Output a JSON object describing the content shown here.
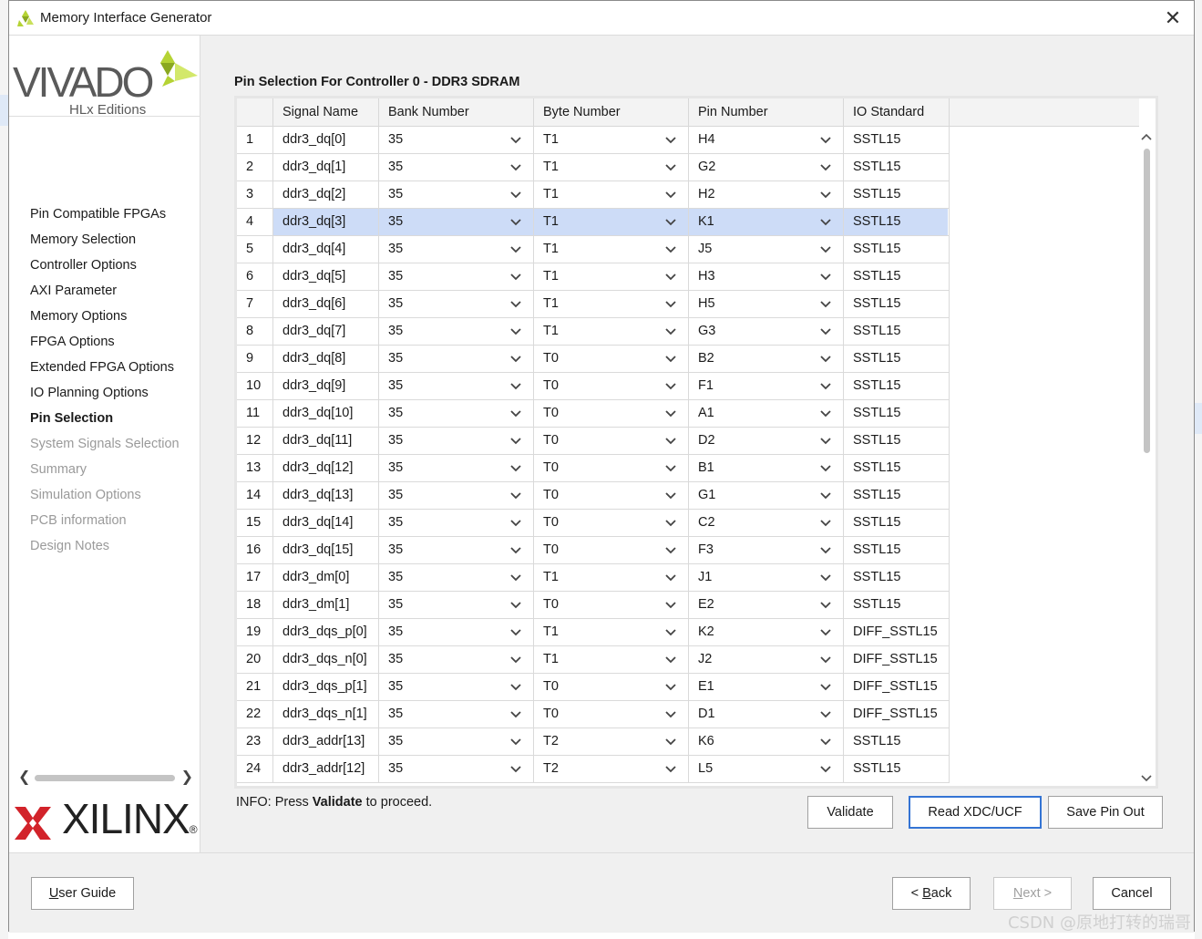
{
  "window": {
    "title": "Memory Interface Generator",
    "close_glyph": "✕"
  },
  "brand": {
    "vivado": "VIVADO",
    "vivado_sub": "HLx Editions",
    "xilinx": "XILINX",
    "registered": "®",
    "accent_green": "#b5d334"
  },
  "steps": [
    {
      "label": "Pin Compatible FPGAs",
      "state": "done"
    },
    {
      "label": "Memory Selection",
      "state": "done"
    },
    {
      "label": "Controller Options",
      "state": "done"
    },
    {
      "label": "AXI Parameter",
      "state": "done"
    },
    {
      "label": "Memory Options",
      "state": "done"
    },
    {
      "label": "FPGA Options",
      "state": "done"
    },
    {
      "label": "Extended FPGA Options",
      "state": "done"
    },
    {
      "label": "IO Planning Options",
      "state": "done"
    },
    {
      "label": "Pin Selection",
      "state": "current"
    },
    {
      "label": "System Signals Selection",
      "state": "disabled"
    },
    {
      "label": "Summary",
      "state": "disabled"
    },
    {
      "label": "Simulation Options",
      "state": "disabled"
    },
    {
      "label": "PCB information",
      "state": "disabled"
    },
    {
      "label": "Design Notes",
      "state": "disabled"
    }
  ],
  "left_scroll": {
    "left": "❮",
    "right": "❯"
  },
  "section_title": "Pin Selection For Controller 0 - DDR3 SDRAM",
  "table": {
    "columns": [
      "",
      "Signal Name",
      "Bank Number",
      "Byte Number",
      "Pin Number",
      "IO Standard"
    ],
    "selected_row": 4,
    "rows": [
      {
        "n": "1",
        "signal": "ddr3_dq[0]",
        "bank": "35",
        "byte": "T1",
        "pin": "H4",
        "io": "SSTL15"
      },
      {
        "n": "2",
        "signal": "ddr3_dq[1]",
        "bank": "35",
        "byte": "T1",
        "pin": "G2",
        "io": "SSTL15"
      },
      {
        "n": "3",
        "signal": "ddr3_dq[2]",
        "bank": "35",
        "byte": "T1",
        "pin": "H2",
        "io": "SSTL15"
      },
      {
        "n": "4",
        "signal": "ddr3_dq[3]",
        "bank": "35",
        "byte": "T1",
        "pin": "K1",
        "io": "SSTL15"
      },
      {
        "n": "5",
        "signal": "ddr3_dq[4]",
        "bank": "35",
        "byte": "T1",
        "pin": "J5",
        "io": "SSTL15"
      },
      {
        "n": "6",
        "signal": "ddr3_dq[5]",
        "bank": "35",
        "byte": "T1",
        "pin": "H3",
        "io": "SSTL15"
      },
      {
        "n": "7",
        "signal": "ddr3_dq[6]",
        "bank": "35",
        "byte": "T1",
        "pin": "H5",
        "io": "SSTL15"
      },
      {
        "n": "8",
        "signal": "ddr3_dq[7]",
        "bank": "35",
        "byte": "T1",
        "pin": "G3",
        "io": "SSTL15"
      },
      {
        "n": "9",
        "signal": "ddr3_dq[8]",
        "bank": "35",
        "byte": "T0",
        "pin": "B2",
        "io": "SSTL15"
      },
      {
        "n": "10",
        "signal": "ddr3_dq[9]",
        "bank": "35",
        "byte": "T0",
        "pin": "F1",
        "io": "SSTL15"
      },
      {
        "n": "11",
        "signal": "ddr3_dq[10]",
        "bank": "35",
        "byte": "T0",
        "pin": "A1",
        "io": "SSTL15"
      },
      {
        "n": "12",
        "signal": "ddr3_dq[11]",
        "bank": "35",
        "byte": "T0",
        "pin": "D2",
        "io": "SSTL15"
      },
      {
        "n": "13",
        "signal": "ddr3_dq[12]",
        "bank": "35",
        "byte": "T0",
        "pin": "B1",
        "io": "SSTL15"
      },
      {
        "n": "14",
        "signal": "ddr3_dq[13]",
        "bank": "35",
        "byte": "T0",
        "pin": "G1",
        "io": "SSTL15"
      },
      {
        "n": "15",
        "signal": "ddr3_dq[14]",
        "bank": "35",
        "byte": "T0",
        "pin": "C2",
        "io": "SSTL15"
      },
      {
        "n": "16",
        "signal": "ddr3_dq[15]",
        "bank": "35",
        "byte": "T0",
        "pin": "F3",
        "io": "SSTL15"
      },
      {
        "n": "17",
        "signal": "ddr3_dm[0]",
        "bank": "35",
        "byte": "T1",
        "pin": "J1",
        "io": "SSTL15"
      },
      {
        "n": "18",
        "signal": "ddr3_dm[1]",
        "bank": "35",
        "byte": "T0",
        "pin": "E2",
        "io": "SSTL15"
      },
      {
        "n": "19",
        "signal": "ddr3_dqs_p[0]",
        "bank": "35",
        "byte": "T1",
        "pin": "K2",
        "io": "DIFF_SSTL15"
      },
      {
        "n": "20",
        "signal": "ddr3_dqs_n[0]",
        "bank": "35",
        "byte": "T1",
        "pin": "J2",
        "io": "DIFF_SSTL15"
      },
      {
        "n": "21",
        "signal": "ddr3_dqs_p[1]",
        "bank": "35",
        "byte": "T0",
        "pin": "E1",
        "io": "DIFF_SSTL15"
      },
      {
        "n": "22",
        "signal": "ddr3_dqs_n[1]",
        "bank": "35",
        "byte": "T0",
        "pin": "D1",
        "io": "DIFF_SSTL15"
      },
      {
        "n": "23",
        "signal": "ddr3_addr[13]",
        "bank": "35",
        "byte": "T2",
        "pin": "K6",
        "io": "SSTL15"
      },
      {
        "n": "24",
        "signal": "ddr3_addr[12]",
        "bank": "35",
        "byte": "T2",
        "pin": "L5",
        "io": "SSTL15"
      }
    ]
  },
  "info": {
    "prefix": "INFO: Press ",
    "keyword": "Validate",
    "suffix": " to proceed."
  },
  "actions": {
    "validate": "Validate",
    "read_xdc": "Read XDC/UCF",
    "save_pin_out": "Save Pin Out"
  },
  "footer": {
    "user_guide": "User Guide",
    "back": "< Back",
    "next": "Next >",
    "cancel": "Cancel"
  },
  "watermark": "CSDN @原地打转的瑞哥",
  "colors": {
    "selection": "#cddcf7",
    "focus": "#3474d4",
    "xilinx_red": "#d2232a"
  }
}
